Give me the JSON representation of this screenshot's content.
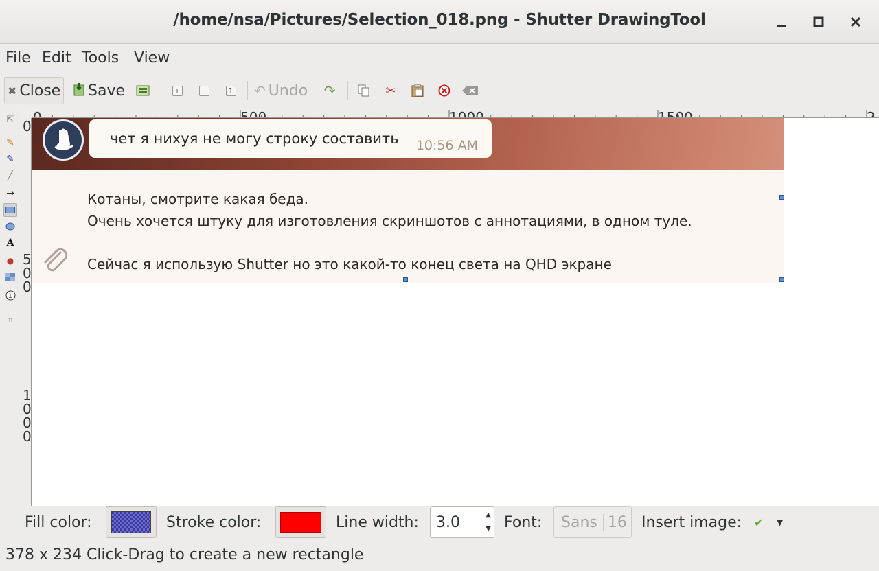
{
  "window": {
    "title": "/home/nsa/Pictures/Selection_018.png - Shutter DrawingTool",
    "minimize_glyph": "—",
    "maximize_glyph": "□",
    "close_glyph": "✕"
  },
  "menu": {
    "items": [
      "File",
      "Edit",
      "Tools",
      "View"
    ]
  },
  "toolbar": {
    "close_label": "Close",
    "save_label": "Save",
    "undo_label": "Undo",
    "icons": [
      "close-icon",
      "save-icon",
      "export-icon",
      "zoom-in-icon",
      "zoom-out-icon",
      "zoom-normal-icon",
      "undo-icon",
      "redo-icon",
      "copy-icon",
      "cut-icon",
      "paste-icon",
      "delete-icon",
      "clear-icon"
    ]
  },
  "palette": {
    "tools": [
      "select-tool",
      "freehand-tool",
      "highlighter-tool",
      "line-tool",
      "arrow-tool",
      "rectangle-tool",
      "ellipse-tool",
      "text-tool",
      "censor-tool",
      "pixelate-tool",
      "number-tool",
      "crop-tool"
    ],
    "active": "rectangle-tool"
  },
  "rulers": {
    "horizontal": [
      "0",
      "500",
      "1000",
      "1500",
      "2"
    ],
    "vertical": [
      "0",
      "500",
      "1000"
    ]
  },
  "canvas": {
    "chat_bubble": {
      "text": "чет я нихуя не могу строку составить",
      "time": "10:56 AM"
    },
    "message": {
      "line1": "Котаны, смотрите какая беда.",
      "line2": "Очень хочется штуку для изготовления скриншотов с аннотациями, в одном туле.",
      "line3": "Сейчас я использую Shutter но это какой-то конец света на QHD экране"
    },
    "colors": {
      "header_dark": "#5a2820",
      "header_light": "#d4907a",
      "body_bg": "#fbf6f1"
    }
  },
  "properties": {
    "fill_label": "Fill color:",
    "fill_color": "#3a3aa0",
    "stroke_label": "Stroke color:",
    "stroke_color": "#ff0000",
    "line_width_label": "Line width:",
    "line_width_value": "3.0",
    "font_label": "Font:",
    "font_name": "Sans",
    "font_size": "16",
    "insert_image_label": "Insert image:"
  },
  "status": {
    "text": "378 x 234 Click-Drag to create a new rectangle"
  }
}
